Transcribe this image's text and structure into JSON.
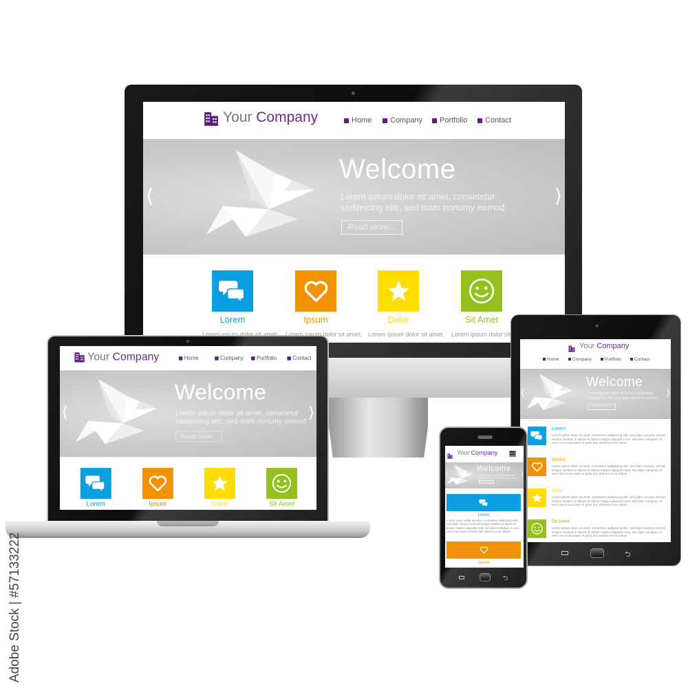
{
  "site": {
    "company_prefix": "Your ",
    "company_name": "Company",
    "nav": [
      "Home",
      "Company",
      "Portfolio",
      "Contact"
    ],
    "hero_title": "Welcome",
    "hero_line1": "Lorem ipsum dolor sit amet, consetetur",
    "hero_line2": "sadipscing elitr, sed diam nonumy eirmod",
    "read_more": "Read more...",
    "features": [
      {
        "title": "Lorem",
        "color": "#0a9fe0",
        "icon": "chat-bubbles-icon"
      },
      {
        "title": "Ipsum",
        "color": "#f39200",
        "icon": "heart-icon"
      },
      {
        "title": "Dolor",
        "color": "#ffdd00",
        "icon": "star-icon"
      },
      {
        "title": "Sit Amet",
        "color": "#95c11f",
        "icon": "smiley-icon"
      }
    ],
    "feature_snippet": "Lorem ipsum dolor sit amet,",
    "feature_text": "Lorem ipsum dolor sit amet, consetetur sadipscing elitr, sed diam nonumy eirmod tempor invidunt ut labore et dolore magna aliquyam erat, sed diam voluptua. At vero eos et accusam et justo duo dolores et ea rebum.",
    "accent_color": "#5c1f80"
  },
  "watermark": "Adobe Stock | #57133222"
}
